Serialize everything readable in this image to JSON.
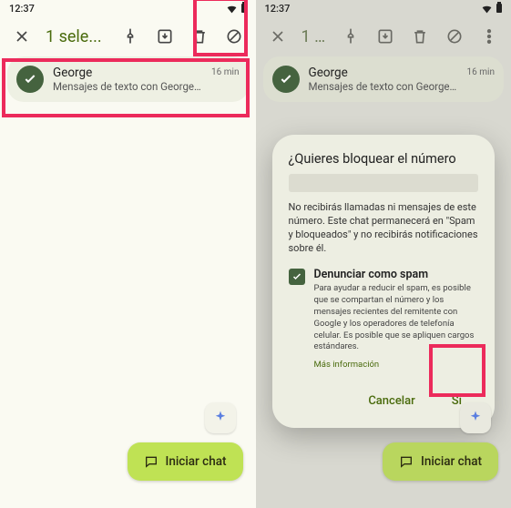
{
  "status": {
    "time": "12:37"
  },
  "appbar": {
    "title": "1 sele..."
  },
  "conversation": {
    "name": "George",
    "snippet": "Mensajes de texto con George (SMS/...",
    "time": "16 min"
  },
  "fab": {
    "label": "Iniciar chat"
  },
  "dialog": {
    "title": "¿Quieres bloquear el número",
    "description": "No recibirás llamadas ni mensajes de este número. Este chat permanecerá en \"Spam y bloqueados\" y no recibirás notificaciones sobre él.",
    "checkbox": {
      "title": "Denunciar como spam",
      "description": "Para ayudar a reducir el spam, es posible que se compartan el número y los mensajes recientes del remitente con Google y los operadores de telefonía celular. Es posible que se apliquen cargos estándares.",
      "more": "Más información"
    },
    "actions": {
      "cancel": "Cancelar",
      "confirm": "Sí"
    }
  }
}
